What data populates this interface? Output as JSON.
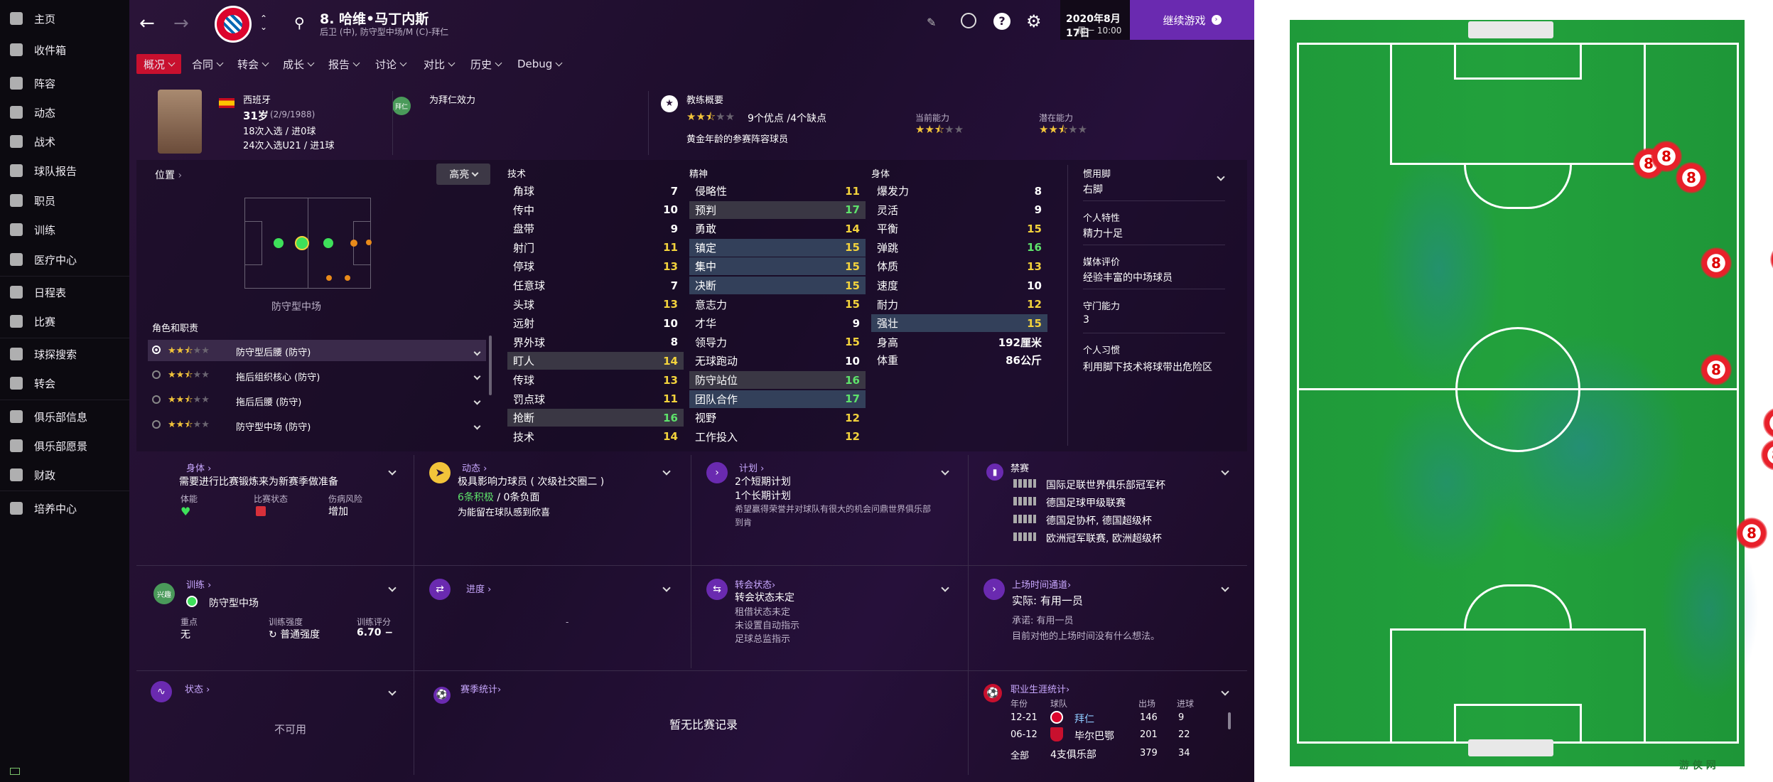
{
  "sidebar": {
    "items": [
      {
        "label": "主页",
        "icon": "home-icon"
      },
      {
        "label": "收件箱",
        "icon": "inbox-icon"
      },
      {
        "label": "阵容",
        "icon": "shirt-icon"
      },
      {
        "label": "动态",
        "icon": "dynamics-icon"
      },
      {
        "label": "战术",
        "icon": "tactics-icon"
      },
      {
        "label": "球队报告",
        "icon": "report-icon"
      },
      {
        "label": "职员",
        "icon": "staff-icon"
      },
      {
        "label": "训练",
        "icon": "training-icon"
      },
      {
        "label": "医疗中心",
        "icon": "medical-icon"
      },
      {
        "label": "日程表",
        "icon": "calendar-icon"
      },
      {
        "label": "比赛",
        "icon": "trophy-icon"
      },
      {
        "label": "球探搜索",
        "icon": "search-icon"
      },
      {
        "label": "转会",
        "icon": "transfer-icon"
      },
      {
        "label": "俱乐部信息",
        "icon": "shield-icon"
      },
      {
        "label": "俱乐部愿景",
        "icon": "briefcase-icon"
      },
      {
        "label": "财政",
        "icon": "money-icon"
      },
      {
        "label": "培养中心",
        "icon": "development-icon"
      }
    ]
  },
  "header": {
    "player_title": "8. 哈维•马丁内斯",
    "player_sub": "后卫 (中), 防守型中场/M (C)-拜仁",
    "date": "2020年8月17日",
    "time": "周一 10:00",
    "continue": "继续游戏",
    "club_logo_text": "FC BAYERN MÜNCHEN"
  },
  "tabs": [
    "概况",
    "合同",
    "转会",
    "成长",
    "报告",
    "讨论",
    "对比",
    "历史",
    "Debug"
  ],
  "profile": {
    "nation": "西班牙",
    "age": "31岁",
    "birth": "(2/9/1988)",
    "caps": "18次入选 / 进0球",
    "u21": "24次入选U21 / 进1球",
    "club_badge": "拜仁",
    "plays_for": "为拜仁效力",
    "coach_title": "教练概要",
    "coach_summary": "9个优点 /4个缺点",
    "coach_note": "黄金年龄的参赛阵容球员",
    "ca_label": "当前能力",
    "pa_label": "潜在能力"
  },
  "position": {
    "title": "位置",
    "highlight": "高亮",
    "role_name": "防守型中场",
    "roles_title": "角色和职责",
    "roles": [
      "防守型后腰 (防守)",
      "拖后组织核心 (防守)",
      "拖后后腰 (防守)",
      "防守型中场 (防守)"
    ]
  },
  "attributes": {
    "tech_title": "技术",
    "mental_title": "精神",
    "phys_title": "身体",
    "technical": [
      [
        "角球",
        "7"
      ],
      [
        "传中",
        "10"
      ],
      [
        "盘带",
        "9"
      ],
      [
        "射门",
        "11"
      ],
      [
        "停球",
        "13"
      ],
      [
        "任意球",
        "7"
      ],
      [
        "头球",
        "13"
      ],
      [
        "远射",
        "10"
      ],
      [
        "界外球",
        "8"
      ],
      [
        "盯人",
        "14"
      ],
      [
        "传球",
        "13"
      ],
      [
        "罚点球",
        "11"
      ],
      [
        "抢断",
        "16"
      ],
      [
        "技术",
        "14"
      ]
    ],
    "mental": [
      [
        "侵略性",
        "11"
      ],
      [
        "预判",
        "17"
      ],
      [
        "勇敢",
        "14"
      ],
      [
        "镇定",
        "15"
      ],
      [
        "集中",
        "15"
      ],
      [
        "决断",
        "15"
      ],
      [
        "意志力",
        "15"
      ],
      [
        "才华",
        "9"
      ],
      [
        "领导力",
        "15"
      ],
      [
        "无球跑动",
        "10"
      ],
      [
        "防守站位",
        "16"
      ],
      [
        "团队合作",
        "17"
      ],
      [
        "视野",
        "12"
      ],
      [
        "工作投入",
        "12"
      ]
    ],
    "physical": [
      [
        "爆发力",
        "8"
      ],
      [
        "灵活",
        "9"
      ],
      [
        "平衡",
        "15"
      ],
      [
        "弹跳",
        "16"
      ],
      [
        "体质",
        "13"
      ],
      [
        "速度",
        "10"
      ],
      [
        "耐力",
        "12"
      ],
      [
        "强壮",
        "15"
      ]
    ],
    "height_label": "身高",
    "height": "192厘米",
    "weight_label": "体重",
    "weight": "86公斤"
  },
  "traits": [
    {
      "t": "惯用脚",
      "v": "右脚"
    },
    {
      "t": "个人特性",
      "v": "精力十足"
    },
    {
      "t": "媒体评价",
      "v": "经验丰富的中场球员"
    },
    {
      "t": "守门能力",
      "v": "3"
    },
    {
      "t": "个人习惯",
      "v": "利用脚下技术将球带出危险区"
    }
  ],
  "cards": {
    "body": {
      "title": "身体",
      "desc": "需要进行比赛锻炼来为新赛季做准备",
      "c1": "体能",
      "c2": "比赛状态",
      "c3": "伤病风险",
      "c3v": "增加"
    },
    "dynamics": {
      "title": "动态",
      "l1": "极具影响力球员 ( 次级社交圈二 )",
      "l2a": "6条积极",
      "l2b": "/ 0条负面",
      "l3": "为能留在球队感到欣喜"
    },
    "plan": {
      "title": "计划",
      "l1": "2个短期计划",
      "l2": "1个长期计划",
      "l3": "希望赢得荣誉并对球队有很大的机会问鼎世界俱乐部",
      "l4": "到肯"
    },
    "bans": {
      "title": "禁赛",
      "items": [
        "国际足联世界俱乐部冠军杯",
        "德国足球甲级联赛",
        "德国足协杯, 德国超级杯",
        "欧洲冠军联赛, 欧洲超级杯"
      ]
    },
    "training": {
      "title": "训练",
      "badge": "兴趣",
      "role": "防守型中场",
      "focus_l": "重点",
      "focus_v": "无",
      "int_l": "训练强度",
      "int_v": "普通强度",
      "rate_l": "训练评分",
      "rate_v": "6.70"
    },
    "progress": {
      "title": "进度",
      "dash": "-"
    },
    "transfer": {
      "title": "转会状态",
      "l1": "转会状态未定",
      "l2": "租借状态未定",
      "l3": "未设置自动指示",
      "l4": "足球总监指示"
    },
    "playtime": {
      "title": "上场时间通道",
      "l1": "实际: 有用一员",
      "l2": "承诺: 有用一员",
      "l3": "目前对他的上场时间没有什么想法。"
    },
    "form": {
      "title": "状态",
      "na": "不可用"
    },
    "season": {
      "title": "赛季统计",
      "empty": "暂无比赛记录"
    },
    "career": {
      "title": "职业生涯统计",
      "h_year": "年份",
      "h_team": "球队",
      "h_apps": "出场",
      "h_goals": "进球",
      "rows": [
        [
          "12-21",
          "拜仁",
          "146",
          "9"
        ],
        [
          "06-12",
          "毕尔巴鄂",
          "201",
          "22"
        ],
        [
          "全部",
          "4支俱乐部",
          "379",
          "34"
        ]
      ]
    }
  },
  "pitch": {
    "player_number": "8",
    "watermark": "游 侠 网"
  },
  "colors": {
    "accent": "#c8102e",
    "purple": "#6a2ab0",
    "green": "#2a8a3a"
  }
}
